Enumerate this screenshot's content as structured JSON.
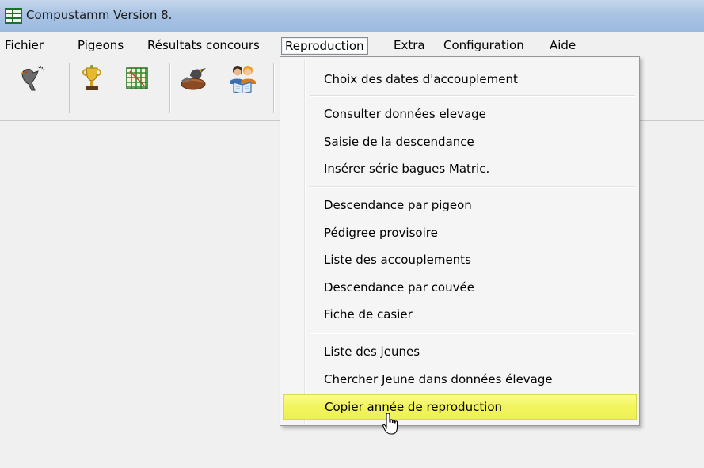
{
  "window": {
    "title": "Compustamm Version 8.",
    "icon": "compustamm-app-icon"
  },
  "menubar": {
    "items": [
      "Fichier",
      "Pigeons",
      "Résultats concours",
      "Reproduction",
      "Extra",
      "Configuration",
      "Aide"
    ],
    "active": "Reproduction"
  },
  "toolbar": {
    "buttons": [
      "pigeon-icon",
      "trophy-icon",
      "grid-icon",
      "nest-icon",
      "people-book-icon"
    ]
  },
  "reproduction_menu": {
    "groups": [
      [
        "Choix des dates d'accouplement"
      ],
      [
        "Consulter données elevage",
        "Saisie de la descendance",
        "Insérer série bagues Matric."
      ],
      [
        "Descendance par pigeon",
        "Pédigree provisoire",
        "Liste des accouplements",
        "Descendance par couvée",
        "Fiche de casier"
      ],
      [
        "Liste des jeunes",
        "Chercher Jeune dans données élevage",
        "Copier année de reproduction"
      ]
    ],
    "highlighted": "Copier année de reproduction",
    "highlight_color": "#f2f45d"
  },
  "colors": {
    "titlebar": "#a9c3e3",
    "background": "#f0f0f0",
    "menu_background": "#f5f5f5"
  }
}
